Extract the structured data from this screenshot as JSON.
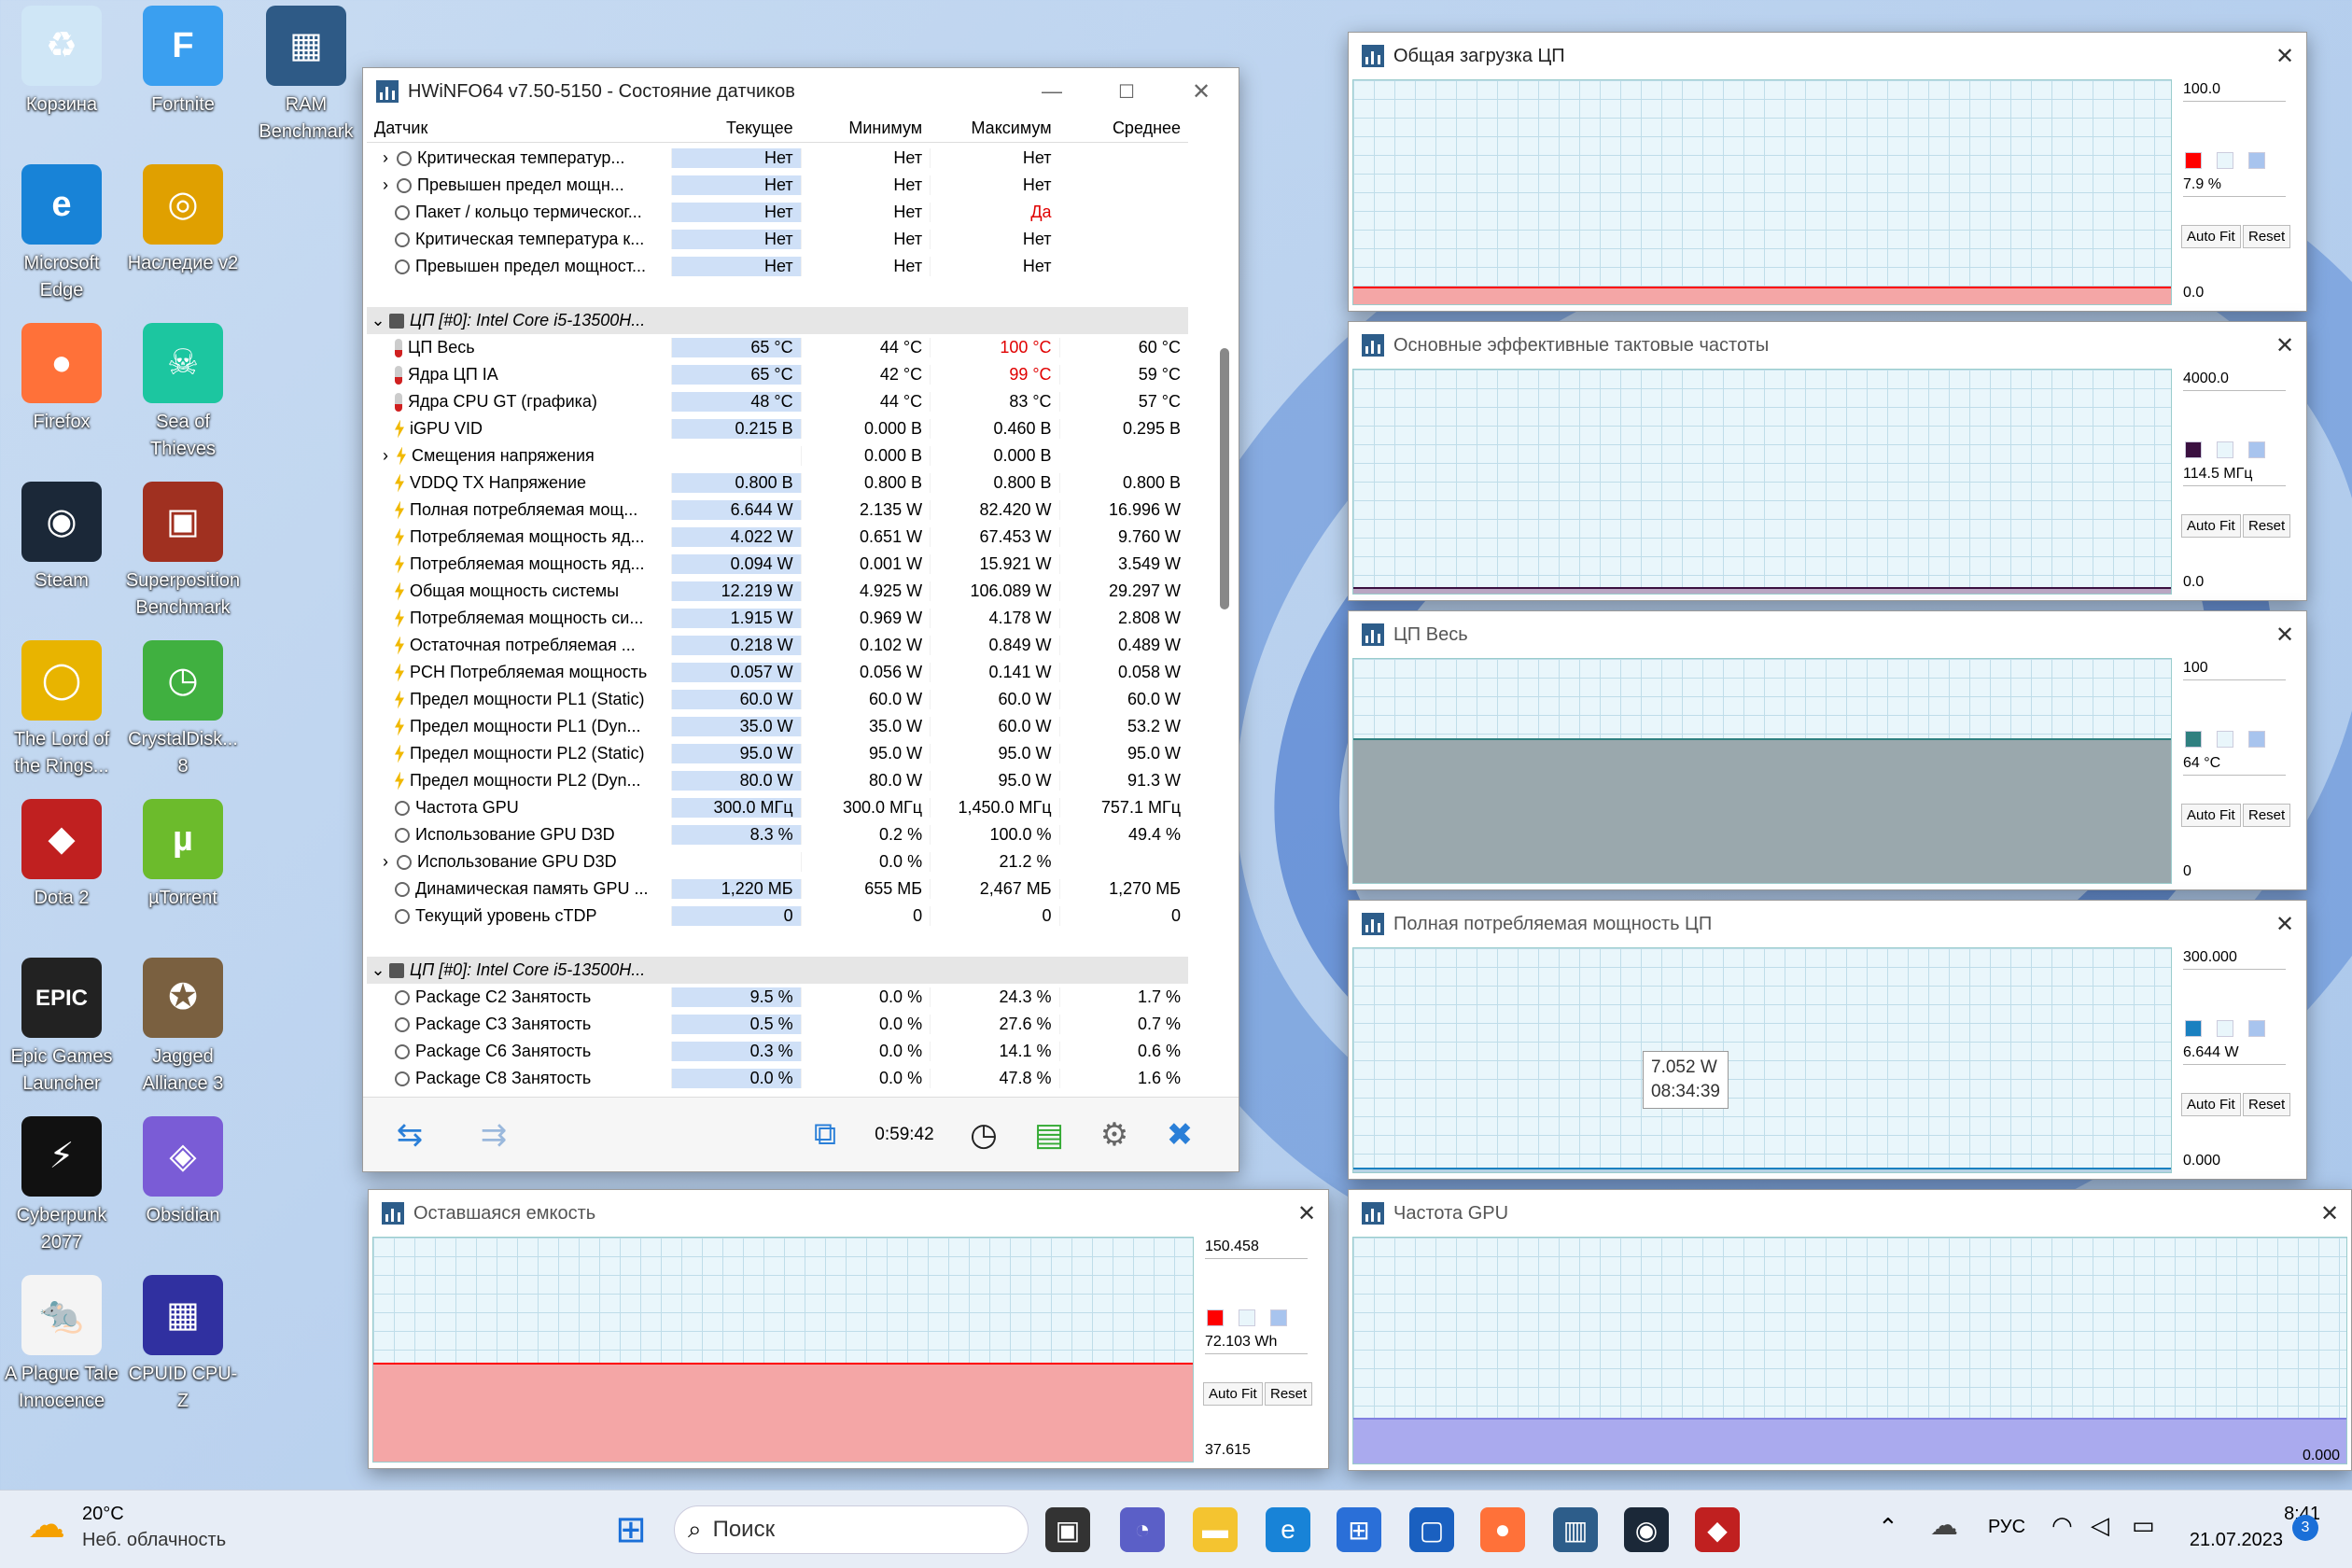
{
  "desktop": {
    "icons": [
      {
        "label": "Корзина",
        "glyph": "♻",
        "color": "#cfe6f6"
      },
      {
        "label": "Fortnite",
        "glyph": "F",
        "color": "#3a9ff0"
      },
      {
        "label": "RAM Benchmark",
        "glyph": "▦",
        "color": "#2e5a86"
      },
      {
        "label": "Microsoft Edge",
        "glyph": "e",
        "color": "#1883d7"
      },
      {
        "label": "Наследие v2",
        "glyph": "◎",
        "color": "#e0a000"
      },
      {
        "label": "Firefox",
        "glyph": "●",
        "color": "#ff7139"
      },
      {
        "label": "Sea of Thieves",
        "glyph": "☠",
        "color": "#1cc6a0"
      },
      {
        "label": "Steam",
        "glyph": "◉",
        "color": "#1b2838"
      },
      {
        "label": "Superposition Benchmark",
        "glyph": "▣",
        "color": "#a03020"
      },
      {
        "label": "The Lord of the Rings...",
        "glyph": "◯",
        "color": "#e8b400"
      },
      {
        "label": "CrystalDisk... 8",
        "glyph": "◷",
        "color": "#40b040"
      },
      {
        "label": "Dota 2",
        "glyph": "◆",
        "color": "#c02020"
      },
      {
        "label": "µTorrent",
        "glyph": "µ",
        "color": "#6cbb2c"
      },
      {
        "label": "Epic Games Launcher",
        "glyph": "EPIC",
        "color": "#222222"
      },
      {
        "label": "Jagged Alliance 3",
        "glyph": "✪",
        "color": "#7a6040"
      },
      {
        "label": "Cyberpunk 2077",
        "glyph": "⚡",
        "color": "#111111"
      },
      {
        "label": "Obsidian",
        "glyph": "◈",
        "color": "#7a5cd6"
      },
      {
        "label": "A Plague Tale Innocence",
        "glyph": "🐀",
        "color": "#f4f4f4"
      },
      {
        "label": "CPUID CPU-Z",
        "glyph": "▦",
        "color": "#3030a0"
      }
    ]
  },
  "hwinfo": {
    "title": "HWiNFO64 v7.50-5150 - Состояние датчиков",
    "columns": [
      "Датчик",
      "Текущее",
      "Минимум",
      "Максимум",
      "Среднее"
    ],
    "rows": [
      {
        "t": "r",
        "ind": ">",
        "ic": "circ",
        "name": "Критическая температур...",
        "v": [
          "Нет",
          "Нет",
          "Нет",
          ""
        ]
      },
      {
        "t": "r",
        "ind": ">",
        "ic": "circ",
        "name": "Превышен предел мощн...",
        "v": [
          "Нет",
          "Нет",
          "Нет",
          ""
        ]
      },
      {
        "t": "r",
        "ind": "",
        "ic": "circ",
        "name": "Пакет / кольцо термическог...",
        "v": [
          "Нет",
          "Нет",
          "Да",
          ""
        ],
        "red": [
          2
        ]
      },
      {
        "t": "r",
        "ind": "",
        "ic": "circ",
        "name": "Критическая температура к...",
        "v": [
          "Нет",
          "Нет",
          "Нет",
          ""
        ]
      },
      {
        "t": "r",
        "ind": "",
        "ic": "circ",
        "name": "Превышен предел мощност...",
        "v": [
          "Нет",
          "Нет",
          "Нет",
          ""
        ]
      },
      {
        "t": "b"
      },
      {
        "t": "g",
        "ind": "v",
        "name": "ЦП [#0]: Intel Core i5-13500H..."
      },
      {
        "t": "r",
        "ic": "therm",
        "name": "ЦП Весь",
        "v": [
          "65 °C",
          "44 °C",
          "100 °C",
          "60 °C"
        ],
        "red": [
          2
        ]
      },
      {
        "t": "r",
        "ic": "therm",
        "name": "Ядра ЦП IA",
        "v": [
          "65 °C",
          "42 °C",
          "99 °C",
          "59 °C"
        ],
        "red": [
          2
        ]
      },
      {
        "t": "r",
        "ic": "therm",
        "name": "Ядра CPU GT (графика)",
        "v": [
          "48 °C",
          "44 °C",
          "83 °C",
          "57 °C"
        ]
      },
      {
        "t": "r",
        "ic": "volt",
        "name": "iGPU VID",
        "v": [
          "0.215 В",
          "0.000 В",
          "0.460 В",
          "0.295 В"
        ]
      },
      {
        "t": "r",
        "ind": ">",
        "ic": "volt",
        "name": "Смещения напряжения",
        "v": [
          "",
          "0.000 В",
          "0.000 В",
          ""
        ]
      },
      {
        "t": "r",
        "ic": "volt",
        "name": "VDDQ TX Напряжение",
        "v": [
          "0.800 В",
          "0.800 В",
          "0.800 В",
          "0.800 В"
        ]
      },
      {
        "t": "r",
        "ic": "volt",
        "name": "Полная потребляемая мощ...",
        "v": [
          "6.644 W",
          "2.135 W",
          "82.420 W",
          "16.996 W"
        ]
      },
      {
        "t": "r",
        "ic": "volt",
        "name": "Потребляемая мощность яд...",
        "v": [
          "4.022 W",
          "0.651 W",
          "67.453 W",
          "9.760 W"
        ]
      },
      {
        "t": "r",
        "ic": "volt",
        "name": "Потребляемая мощность яд...",
        "v": [
          "0.094 W",
          "0.001 W",
          "15.921 W",
          "3.549 W"
        ]
      },
      {
        "t": "r",
        "ic": "volt",
        "name": "Общая мощность системы",
        "v": [
          "12.219 W",
          "4.925 W",
          "106.089 W",
          "29.297 W"
        ]
      },
      {
        "t": "r",
        "ic": "volt",
        "name": "Потребляемая мощность си...",
        "v": [
          "1.915 W",
          "0.969 W",
          "4.178 W",
          "2.808 W"
        ]
      },
      {
        "t": "r",
        "ic": "volt",
        "name": "Остаточная потребляемая ...",
        "v": [
          "0.218 W",
          "0.102 W",
          "0.849 W",
          "0.489 W"
        ]
      },
      {
        "t": "r",
        "ic": "volt",
        "name": "PCH Потребляемая мощность",
        "v": [
          "0.057 W",
          "0.056 W",
          "0.141 W",
          "0.058 W"
        ]
      },
      {
        "t": "r",
        "ic": "volt",
        "name": "Предел мощности PL1 (Static)",
        "v": [
          "60.0 W",
          "60.0 W",
          "60.0 W",
          "60.0 W"
        ]
      },
      {
        "t": "r",
        "ic": "volt",
        "name": "Предел мощности PL1 (Dyn...",
        "v": [
          "35.0 W",
          "35.0 W",
          "60.0 W",
          "53.2 W"
        ]
      },
      {
        "t": "r",
        "ic": "volt",
        "name": "Предел мощности PL2 (Static)",
        "v": [
          "95.0 W",
          "95.0 W",
          "95.0 W",
          "95.0 W"
        ]
      },
      {
        "t": "r",
        "ic": "volt",
        "name": "Предел мощности PL2 (Dyn...",
        "v": [
          "80.0 W",
          "80.0 W",
          "95.0 W",
          "91.3 W"
        ]
      },
      {
        "t": "r",
        "ic": "circ",
        "name": "Частота GPU",
        "v": [
          "300.0 МГц",
          "300.0 МГц",
          "1,450.0 МГц",
          "757.1 МГц"
        ]
      },
      {
        "t": "r",
        "ic": "circ",
        "name": "Использование GPU D3D",
        "v": [
          "8.3 %",
          "0.2 %",
          "100.0 %",
          "49.4 %"
        ]
      },
      {
        "t": "r",
        "ind": ">",
        "ic": "circ",
        "name": "Использование GPU D3D",
        "v": [
          "",
          "0.0 %",
          "21.2 %",
          ""
        ]
      },
      {
        "t": "r",
        "ic": "circ",
        "name": "Динамическая память GPU ...",
        "v": [
          "1,220 МБ",
          "655 МБ",
          "2,467 МБ",
          "1,270 МБ"
        ]
      },
      {
        "t": "r",
        "ic": "circ",
        "name": "Текущий уровень cTDP",
        "v": [
          "0",
          "0",
          "0",
          "0"
        ]
      },
      {
        "t": "b"
      },
      {
        "t": "g",
        "ind": "v",
        "name": "ЦП [#0]: Intel Core i5-13500H..."
      },
      {
        "t": "r",
        "ic": "circ",
        "name": "Package C2 Занятость",
        "v": [
          "9.5 %",
          "0.0 %",
          "24.3 %",
          "1.7 %"
        ]
      },
      {
        "t": "r",
        "ic": "circ",
        "name": "Package C3 Занятость",
        "v": [
          "0.5 %",
          "0.0 %",
          "27.6 %",
          "0.7 %"
        ]
      },
      {
        "t": "r",
        "ic": "circ",
        "name": "Package C6 Занятость",
        "v": [
          "0.3 %",
          "0.0 %",
          "14.1 %",
          "0.6 %"
        ]
      },
      {
        "t": "r",
        "ic": "circ",
        "name": "Package C8 Занятость",
        "v": [
          "0.0 %",
          "0.0 %",
          "47.8 %",
          "1.6 %"
        ]
      }
    ],
    "timer": "0:59:42"
  },
  "graphs": {
    "cpu_load": {
      "title": "Общая загрузка ЦП",
      "max": "100.0",
      "cur": "7.9 %",
      "min": "0.0",
      "color": "#ff0000",
      "fill": "#f4a6a6",
      "level": 0.08
    },
    "eff_clock": {
      "title": "Основные эффективные тактовые частоты",
      "max": "4000.0",
      "cur": "114.5 МГц",
      "min": "0.0",
      "color": "#3a1040",
      "fill": "#b9a6c2",
      "level": 0.03
    },
    "cpu_temp": {
      "title": "ЦП Весь",
      "max": "100",
      "cur": "64 °C",
      "min": "0",
      "color": "#2f8080",
      "fill": "#9aa8ad",
      "level": 0.64
    },
    "cpu_power": {
      "title": "Полная потребляемая мощность ЦП",
      "max": "300.000",
      "cur": "6.644 W",
      "min": "0.000",
      "color": "#1a80c0",
      "fill": "#b6d2e4",
      "level": 0.02,
      "tooltip": [
        "7.052 W",
        "08:34:39"
      ]
    },
    "battery": {
      "title": "Оставшаяся емкость",
      "max": "150.458",
      "cur": "72.103 Wh",
      "min": "37.615",
      "color": "#ff0000",
      "fill": "#f4a6a6",
      "level": 0.44
    },
    "gpu_freq": {
      "title": "Частота GPU",
      "min": "0.000",
      "color": "#8080e0",
      "fill": "#aaaaee",
      "level": 0.2
    }
  },
  "graph_buttons": {
    "autofit": "Auto Fit",
    "reset": "Reset"
  },
  "taskbar": {
    "weather_temp": "20°C",
    "weather_desc": "Неб. облачность",
    "search": "Поиск",
    "lang": "РУС",
    "time": "8:41",
    "date": "21.07.2023",
    "badge": "3"
  }
}
